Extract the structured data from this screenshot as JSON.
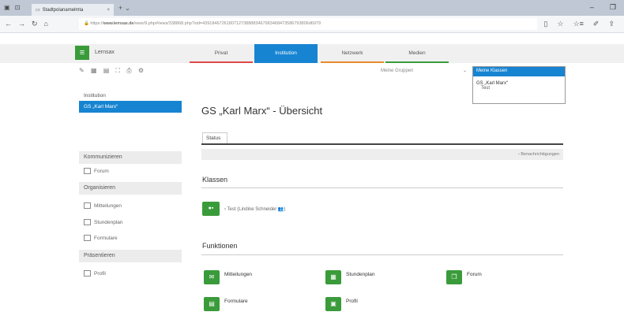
{
  "browser": {
    "tab_title": "Stadtpolanamelmta",
    "tab_close": "×",
    "new_tab": "+  ⌄",
    "url_prefix": "https://",
    "url_host": "www.lernsax.de",
    "url_rest": "/wws/9.php#/wws/338868.php?sid=43918467261807127388883467983468473586793806d6979",
    "window_controls": [
      "–",
      "❐"
    ]
  },
  "app": {
    "brand": "Lernsax",
    "menu_icon": "hamburger-icon",
    "main_tabs": [
      {
        "label": "Privat",
        "color": "#e04848",
        "active": false
      },
      {
        "label": "Institution",
        "color": "#1784d2",
        "active": true
      },
      {
        "label": "Netzwerk",
        "color": "#e88a2a",
        "active": false
      },
      {
        "label": "Medien",
        "color": "#3a9b3a",
        "active": false
      }
    ],
    "tool_icons": "✎ ▦ ▤ ⛶ ⎙ ⚙",
    "groups_select": {
      "value": "Meine Gruppen",
      "chevron": "⌄"
    },
    "classes_dropdown": {
      "highlighted": "Meine Klassen",
      "option": "GS „Karl Marx“",
      "sub_option": "Test"
    }
  },
  "sidebar": {
    "heading": "Institution",
    "active_item": "GS „Karl Marx“",
    "sections": {
      "kommunizieren": "Kommunizieren",
      "organisieren": "Organisieren",
      "praesentieren": "Präsentieren"
    },
    "links": {
      "forum": "Forum",
      "mitteilungen": "Mitteilungen",
      "stundenplan": "Stundenplan",
      "formulare": "Formulare",
      "profil": "Profil"
    }
  },
  "main": {
    "title": "GS „Karl Marx“ - Übersicht",
    "status_tab": "Status",
    "notifications": "› Benachrichtigungen",
    "klassen_heading": "Klassen",
    "klasse_entry": "› Test (Lindine Schneider 👥)",
    "funktionen_heading": "Funktionen",
    "functions": {
      "mitteilungen": "Mitteilungen",
      "stundenplan": "Stundenplan",
      "forum": "Forum",
      "formulare": "Formulare",
      "profil": "Profil"
    }
  }
}
